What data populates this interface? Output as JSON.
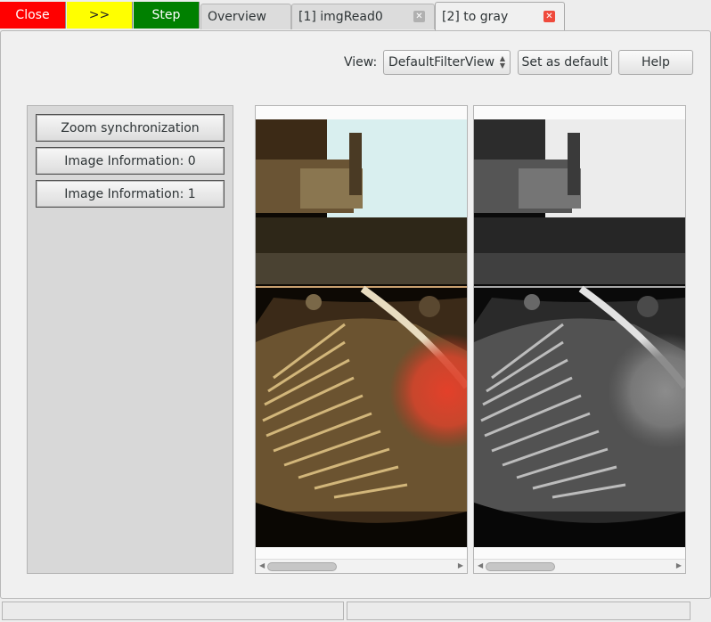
{
  "toolbar": {
    "close_label": "Close",
    "forward_label": ">>",
    "step_label": "Step"
  },
  "tabs": [
    {
      "label": "Overview",
      "active": false,
      "closable": false
    },
    {
      "label": "[1] imgRead0",
      "active": false,
      "closable": true
    },
    {
      "label": "[2] to gray",
      "active": true,
      "closable": true
    }
  ],
  "view": {
    "label": "View:",
    "selected": "DefaultFilterView",
    "set_default_label": "Set as default",
    "help_label": "Help"
  },
  "panel": {
    "buttons": [
      "Zoom synchronization",
      "Image Information: 0",
      "Image Information: 1"
    ]
  },
  "icons": {
    "tab_close": "close-icon",
    "select": "spin-arrows-icon",
    "scroll_left": "arrow-left-icon",
    "scroll_right": "arrow-right-icon"
  },
  "colors": {
    "close": "#ff0000",
    "forward": "#ffff00",
    "step": "#008000",
    "active_tab_close": "#ef4a3c"
  }
}
